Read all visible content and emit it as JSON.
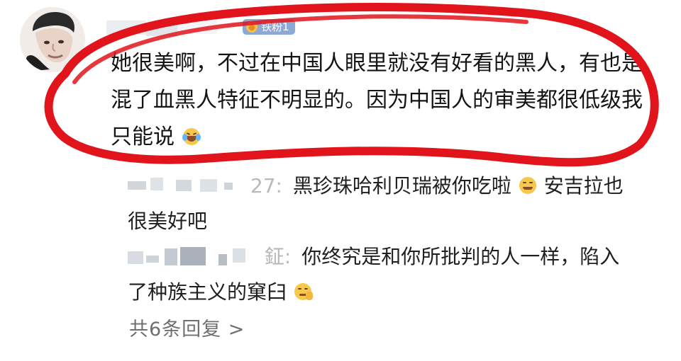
{
  "comment": {
    "badge": "铁粉1",
    "text": "她很美啊，不过在中国人眼里就没有好看的黑人，有也是混了血黑人特征不明显的。因为中国人的审美都很低级我只能说"
  },
  "replies": [
    {
      "name_tail": "27:",
      "text_before": " 黑珍珠哈利贝瑞被你吃啦",
      "text_after": "安吉拉也很美好吧"
    },
    {
      "name_tail": "鉦:",
      "text_before": " 你终究是和你所批判的人一样，陷入了种族主义的窠臼"
    }
  ],
  "footer": {
    "more_replies": "共6条回复 >"
  },
  "colors": {
    "annotation_red": "#e1141b",
    "badge_bg": "#8ea8d6"
  },
  "icons": {
    "laugh_emoji": "laughing-with-tears-emoji",
    "smirk_emoji": "smirking-emoji",
    "thinking_emoji": "thinking-emoji",
    "badge_icon": "fan-badge-icon"
  }
}
